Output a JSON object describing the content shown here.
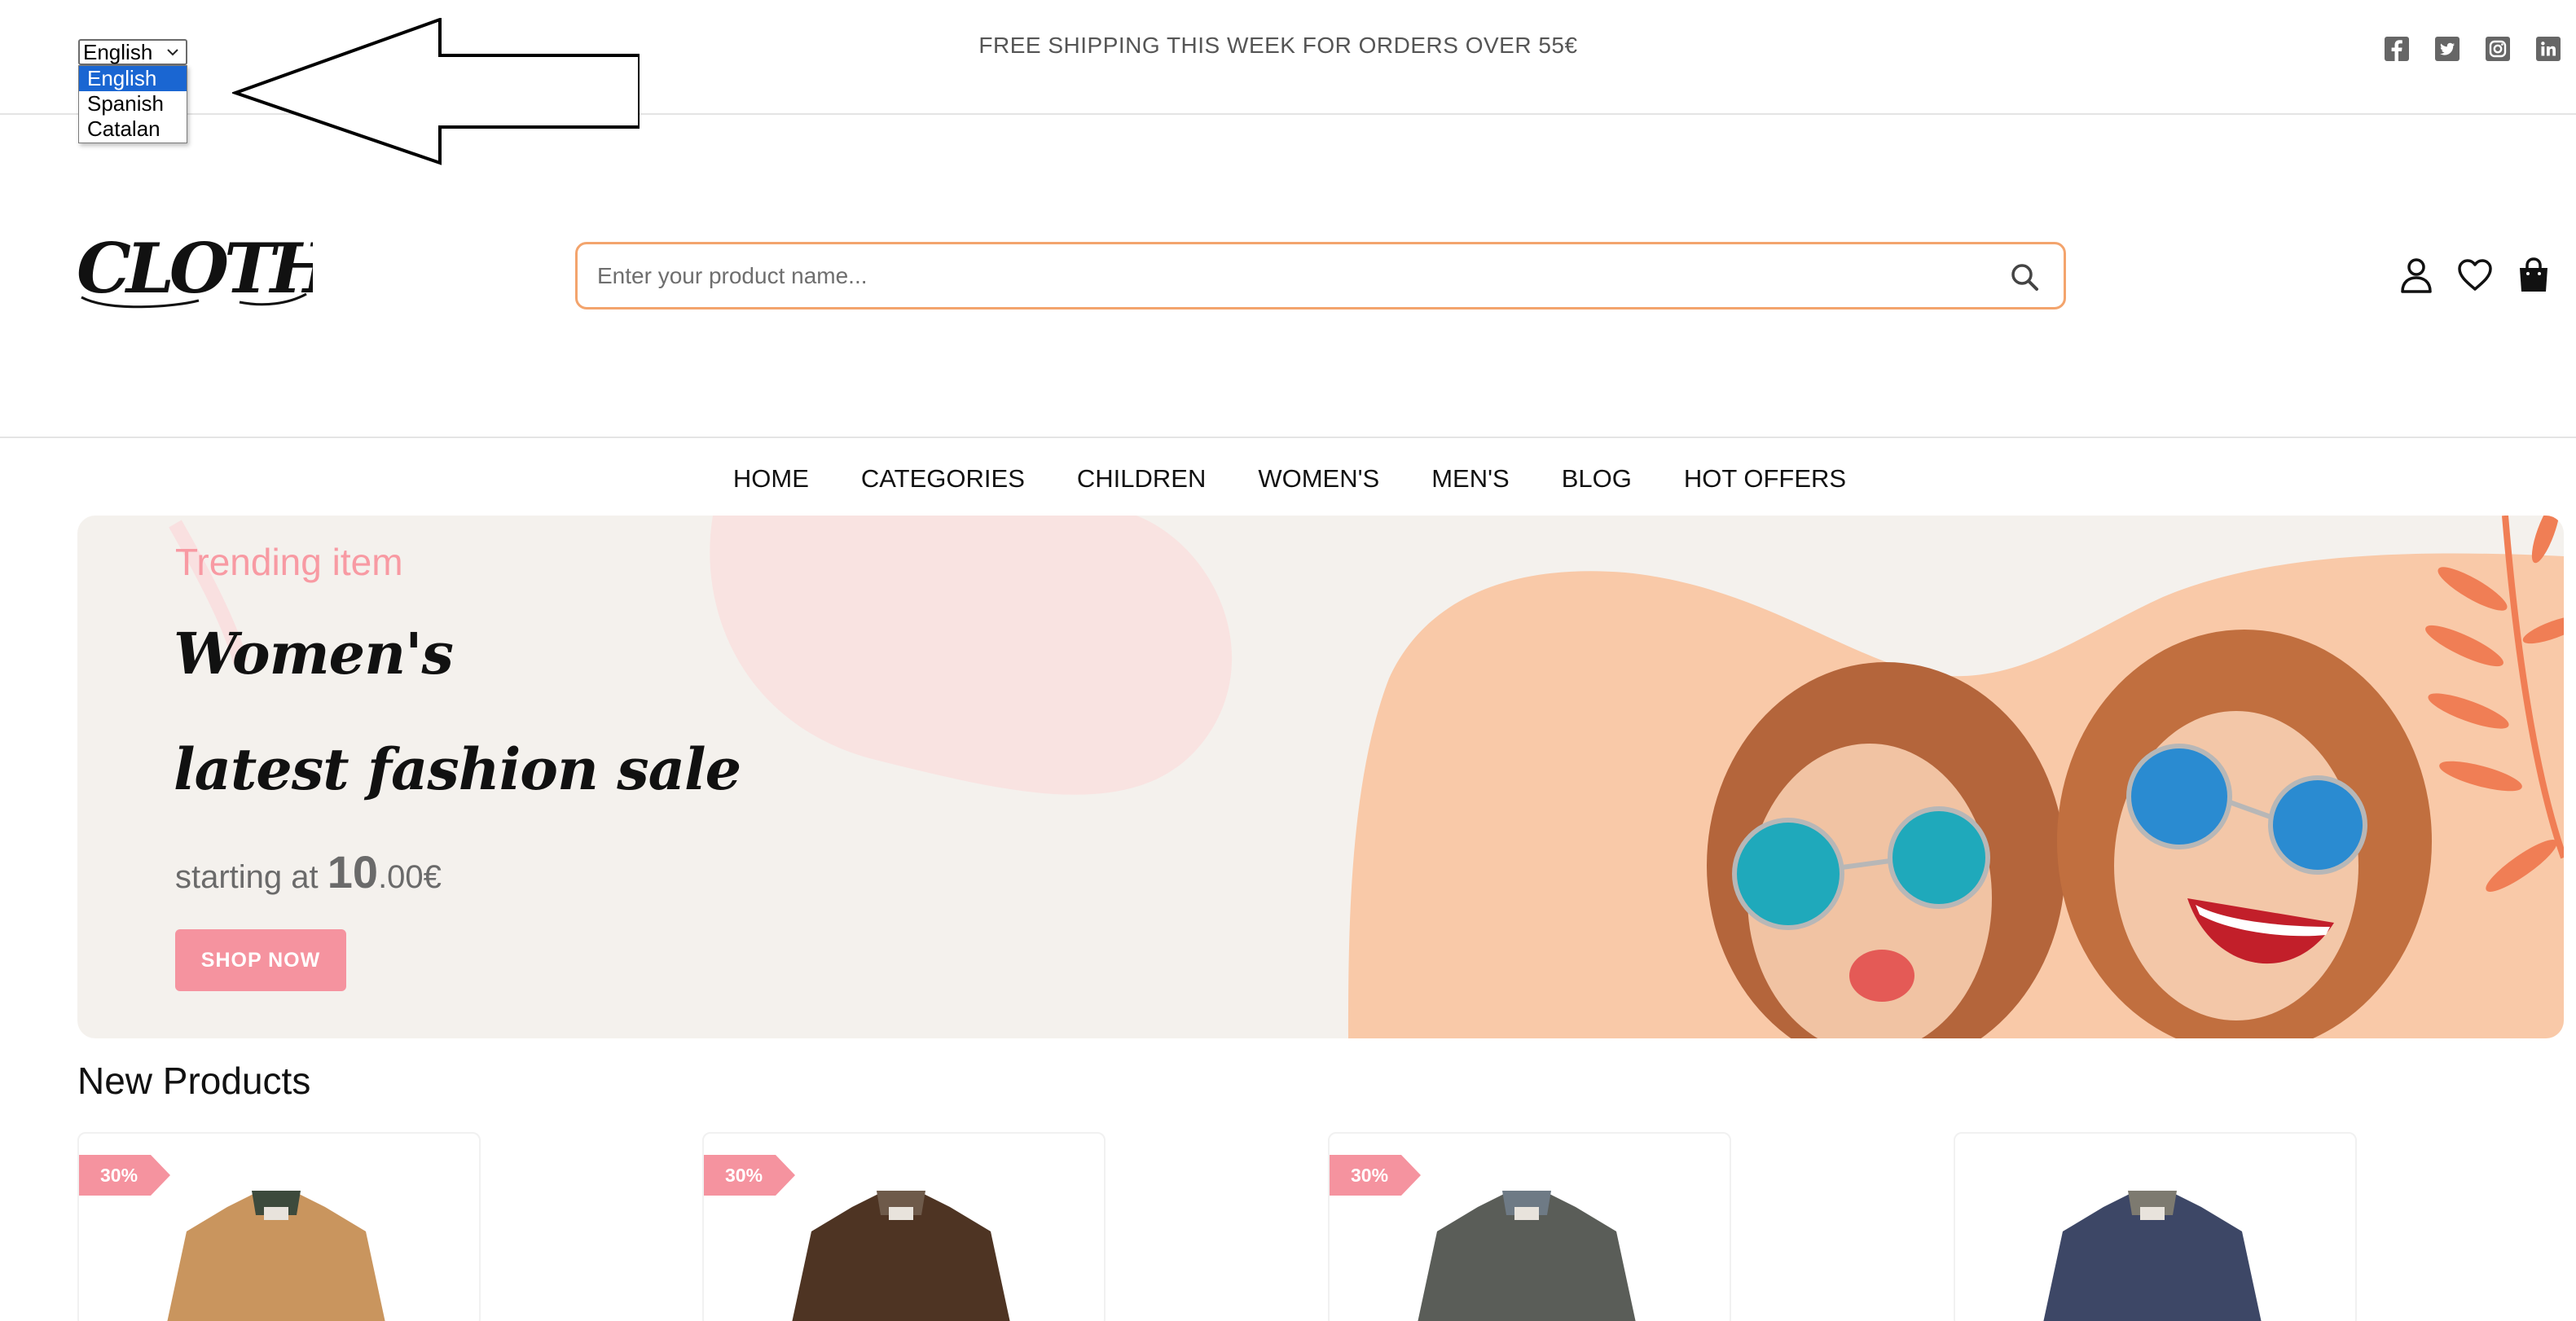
{
  "top_bar": {
    "language": {
      "selected": "English",
      "options": [
        "English",
        "Spanish",
        "Catalan"
      ]
    },
    "promo_text": "FREE SHIPPING THIS WEEK FOR ORDERS OVER 55€",
    "social_icons": [
      "facebook-icon",
      "twitter-icon",
      "instagram-icon",
      "linkedin-icon"
    ]
  },
  "header": {
    "logo_text": "CLOTHES",
    "search": {
      "placeholder": "Enter your product name..."
    },
    "icons": [
      "user-icon",
      "heart-icon",
      "bag-icon"
    ]
  },
  "nav": {
    "items": [
      "HOME",
      "CATEGORIES",
      "CHILDREN",
      "WOMEN'S",
      "MEN'S",
      "BLOG",
      "HOT OFFERS"
    ]
  },
  "hero": {
    "subtitle": "Trending item",
    "title_line1": "Women's",
    "title_line2": "latest fashion sale",
    "price_prefix": "starting at ",
    "price_big": "10",
    "price_small": ".00€",
    "button_label": "SHOP NOW"
  },
  "new_products": {
    "title": "New Products",
    "cards": [
      {
        "badge": "30%",
        "color": "#c9955e"
      },
      {
        "badge": "30%",
        "color": "#4e3423"
      },
      {
        "badge": "30%",
        "color": "#5a5d58"
      },
      {
        "badge": "",
        "color": "#3d4766"
      }
    ]
  },
  "colors": {
    "accent_pink": "#f5939f",
    "search_border": "#f3a46d",
    "hero_bg": "#f4f1ed",
    "hero_peach": "#f9c9a8",
    "leaf_orange": "#f07e55"
  }
}
